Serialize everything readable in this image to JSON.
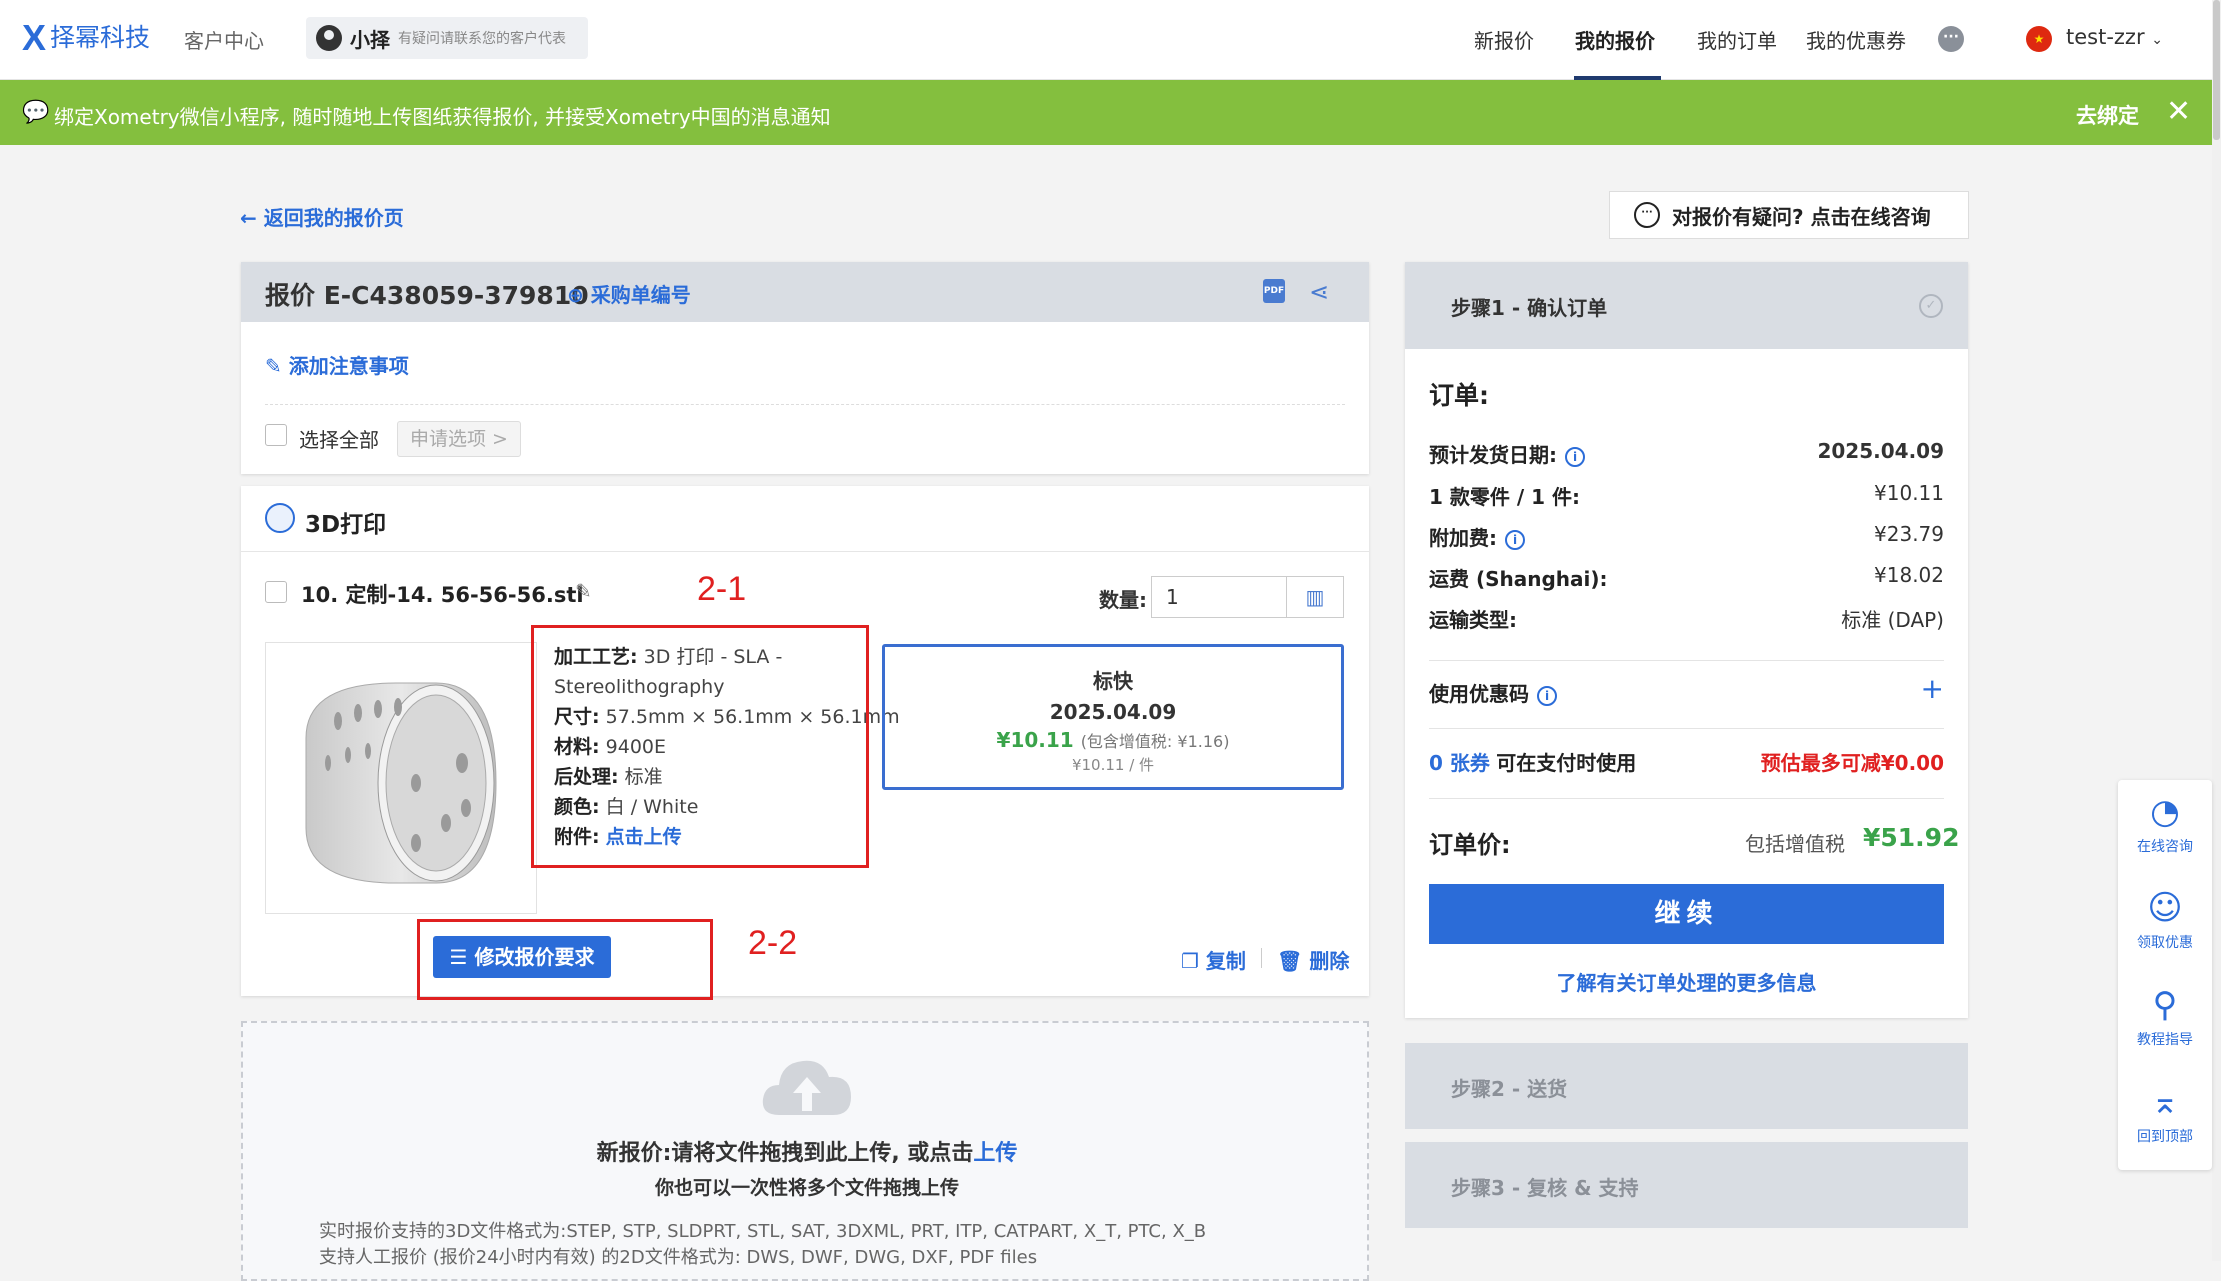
{
  "header": {
    "logo_mark": "X",
    "logo_text": "择幂科技",
    "customer_center": "客户中心",
    "rep_name": "小择",
    "rep_note": "有疑问请联系您的客户代表",
    "nav": [
      "新报价",
      "我的报价",
      "我的订单",
      "我的优惠券"
    ],
    "active_nav": "我的报价",
    "user": "test-zzr"
  },
  "banner": {
    "text": "绑定Xometry微信小程序, 随时随地上传图纸获得报价, 并接受Xometry中国的消息通知",
    "bind_label": "去绑定",
    "close": "✕",
    "color": "#84bf3e"
  },
  "back_link": "← 返回我的报价页",
  "consult": "对报价有疑问? 点击在线咨询",
  "quote": {
    "title": "报价 E-C438059-379810",
    "po_label": "采购单编号",
    "add_note": "添加注意事项",
    "select_all": "选择全部",
    "apply_options": "申请选项 >"
  },
  "part": {
    "section_title": "3D打印",
    "name": "10. 定制-14. 56-56-56.stl",
    "qty_label": "数量:",
    "qty_value": "1",
    "specs": [
      {
        "k": "加工工艺:",
        "v": "3D 打印 - SLA - Stereolithography"
      },
      {
        "k": "尺寸:",
        "v": "57.5mm × 56.1mm × 56.1mm"
      },
      {
        "k": "材料:",
        "v": "9400E"
      },
      {
        "k": "后处理:",
        "v": "标准"
      },
      {
        "k": "颜色:",
        "v": "白 / White"
      },
      {
        "k": "附件:",
        "v": "点击上传"
      }
    ],
    "lead": {
      "title": "标快",
      "date": "2025.04.09",
      "price": "¥10.11",
      "tax": "(包含增值税: ¥1.16)",
      "unit": "¥10.11 / 件"
    },
    "modify_btn": "修改报价要求",
    "copy": "复制",
    "delete": "删除"
  },
  "annotations": {
    "label_1": "2-1",
    "label_2": "2-2"
  },
  "upload": {
    "title_prefix": "新报价:请将文件拖拽到此上传, 或点击",
    "title_link": "上传",
    "subtitle": "你也可以一次性将多个文件拖拽上传",
    "note_1": "实时报价支持的3D文件格式为:STEP, STP, SLDPRT, STL, SAT, 3DXML, PRT, ITP, CATPART, X_T, PTC, X_B",
    "note_2": "支持人工报价 (报价24小时内有效) 的2D文件格式为: DWS, DWF, DWG, DXF, PDF files"
  },
  "order": {
    "step1": "步骤1 - 确认订单",
    "label": "订单:",
    "rows": [
      {
        "k": "预计发货日期:",
        "v": "2025.04.09"
      },
      {
        "k": "1 款零件 / 1 件:",
        "v": "¥10.11"
      },
      {
        "k": "附加费:",
        "v": "¥23.79"
      },
      {
        "k": "运费 (Shanghai):",
        "v": "¥18.02"
      },
      {
        "k": "运输类型:",
        "v": "标准 (DAP)"
      }
    ],
    "coupon_label": "使用优惠码",
    "coupon_count": "0 张券",
    "coupon_usable": "可在支付时使用",
    "coupon_estimate": "预估最多可减¥0.00",
    "total_label": "订单价:",
    "total_tax": "包括增值税",
    "total_value": "¥51.92",
    "continue": "继续",
    "more_info": "了解有关订单处理的更多信息",
    "step2": "步骤2 - 送货",
    "step3": "步骤3 - 复核 & 支持"
  },
  "tools": [
    {
      "label": "在线咨询",
      "icon": "chat-icon"
    },
    {
      "label": "领取优惠",
      "icon": "wechat-icon"
    },
    {
      "label": "教程指导",
      "icon": "search-icon"
    },
    {
      "label": "回到顶部",
      "icon": "top-icon"
    }
  ]
}
